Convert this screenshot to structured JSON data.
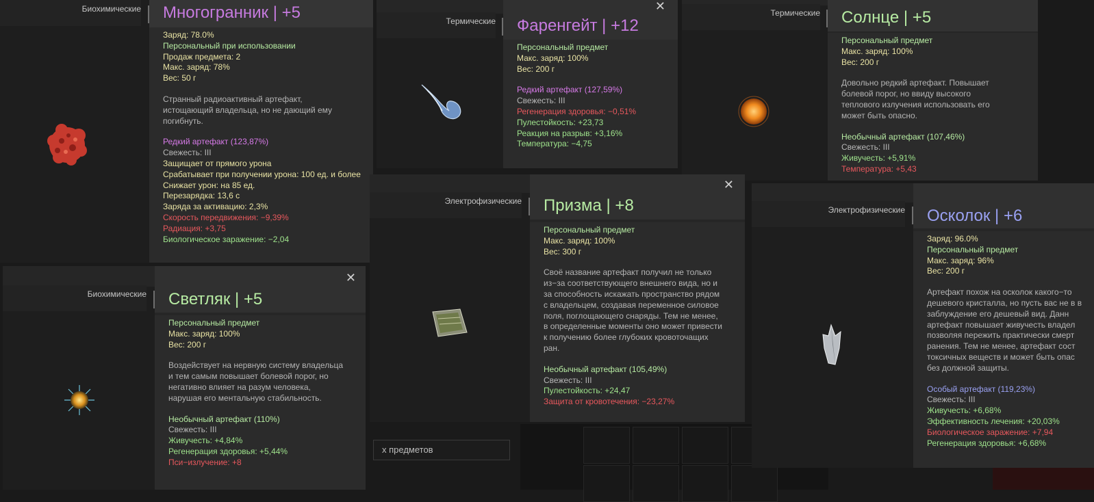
{
  "background": {
    "search_text": "х предметов"
  },
  "cards": {
    "mnogogrannik": {
      "category": "Биохимические",
      "title": "Многогранник | +5",
      "title_color": "#c77be0",
      "lines": [
        {
          "t": "Заряд: 78.0%",
          "c": "c-yellow"
        },
        {
          "t": "Персональный при использовании",
          "c": "c-lgreen"
        },
        {
          "t": "Продаж предмета: 2",
          "c": "c-yellow"
        },
        {
          "t": "Макс. заряд: 78%",
          "c": "c-yellow"
        },
        {
          "t": "Вес: 50 г",
          "c": "c-yellow"
        },
        {
          "gap": true
        },
        {
          "t": "Странный радиоактивный артефакт, истощающий владельца, но не дающий ему погибнуть.",
          "c": "desc",
          "w": 250
        },
        {
          "gap": true
        },
        {
          "t": "Редкий артефакт (123,87%)",
          "c": "c-pink"
        },
        {
          "t": "Свежесть: III",
          "c": "c-gray"
        },
        {
          "t": "Защищает от прямого урона",
          "c": "c-yellow"
        },
        {
          "t": "Срабатывает при получении урона: 100 ед. и более",
          "c": "c-yellow"
        },
        {
          "t": "Снижает урон: на 85 ед.",
          "c": "c-yellow"
        },
        {
          "t": "Перезарядка: 13,6 с",
          "c": "c-yellow"
        },
        {
          "t": "Заряда за активацию: 2,3%",
          "c": "c-yellow"
        },
        {
          "t": "Скорость передвижения: −9,39%",
          "c": "c-red"
        },
        {
          "t": "Радиация: +3,75",
          "c": "c-red"
        },
        {
          "t": "Биологическое заражение: −2,04",
          "c": "c-green"
        }
      ]
    },
    "farengeit": {
      "category": "Термические",
      "title": "Фаренгейт | +12",
      "title_color": "#c77be0",
      "lines": [
        {
          "t": "Персональный предмет",
          "c": "c-lgreen"
        },
        {
          "t": "Макс. заряд: 100%",
          "c": "c-yellow"
        },
        {
          "t": "Вес: 200 г",
          "c": "c-yellow"
        },
        {
          "gap": true
        },
        {
          "t": "Редкий артефакт (127,59%)",
          "c": "c-pink"
        },
        {
          "t": "Свежесть: III",
          "c": "c-gray"
        },
        {
          "t": "Регенерация здоровья: −0,51%",
          "c": "c-red"
        },
        {
          "t": "Пулестойкость: +23,73",
          "c": "c-green"
        },
        {
          "t": "Реакция на разрыв: +3,16%",
          "c": "c-green"
        },
        {
          "t": "Температура: −4,75",
          "c": "c-green"
        }
      ]
    },
    "solnce": {
      "category": "Термические",
      "title": "Солнце | +5",
      "title_color": "#b7eba3",
      "lines": [
        {
          "t": "Персональный предмет",
          "c": "c-lgreen"
        },
        {
          "t": "Макс. заряд: 100%",
          "c": "c-yellow"
        },
        {
          "t": "Вес: 200 г",
          "c": "c-yellow"
        },
        {
          "gap": true
        },
        {
          "t": "Довольно редкий артефакт. Повышает болевой порог, но ввиду высокого теплового излучения использовать его может быть опасно.",
          "c": "desc",
          "w": 240
        },
        {
          "gap": true
        },
        {
          "t": "Необычный артефакт (107,46%)",
          "c": "c-lgreen"
        },
        {
          "t": "Свежесть: III",
          "c": "c-gray"
        },
        {
          "t": "Живучесть: +5,91%",
          "c": "c-green"
        },
        {
          "t": "Температура: +5,43",
          "c": "c-red"
        }
      ]
    },
    "prizma": {
      "category": "Электрофизические",
      "title": "Призма | +8",
      "title_color": "#b7eba3",
      "lines": [
        {
          "t": "Персональный предмет",
          "c": "c-lgreen"
        },
        {
          "t": "Макс. заряд: 100%",
          "c": "c-yellow"
        },
        {
          "t": "Вес: 300 г",
          "c": "c-yellow"
        },
        {
          "gap": true
        },
        {
          "t": "Своё название артефакт получил не только из−за соответствующего внешнего вида, но и за способность искажать пространство рядом с владельцем, создавая переменное силовое поля, поглощающего снаряды. Тем не менее, в определенные моменты оно может привести к получению более глубоких кровоточащих ран.",
          "c": "desc",
          "w": 262
        },
        {
          "gap": true
        },
        {
          "t": "Необычный артефакт (105,49%)",
          "c": "c-lgreen"
        },
        {
          "t": "Свежесть: III",
          "c": "c-gray"
        },
        {
          "t": "Пулестойкость: +24,47",
          "c": "c-green"
        },
        {
          "t": "Защита от кровотечения: −23,27%",
          "c": "c-red"
        }
      ]
    },
    "oskolok": {
      "category": "Электрофизические",
      "title": "Осколок | +6",
      "title_color": "#9aa1f2",
      "lines": [
        {
          "t": "Заряд: 96.0%",
          "c": "c-yellow"
        },
        {
          "t": "Персональный предмет",
          "c": "c-lgreen"
        },
        {
          "t": "Макс. заряд: 96%",
          "c": "c-yellow"
        },
        {
          "t": "Вес: 200 г",
          "c": "c-yellow"
        },
        {
          "gap": true
        },
        {
          "t": "Артефакт похож на осколок какого−то дешевого кристалла, но пусть вас не в в заблуждение его дешевый вид. Данн артефакт повышает живучесть владел позволяя пережить практически смерт ранения. Тем не менее, артефакт сост токсичных веществ и может быть опас без должной защиты.",
          "c": "desc",
          "w": 236
        },
        {
          "gap": true
        },
        {
          "t": "Особый артефакт (119,23%)",
          "c": "c-blue"
        },
        {
          "t": "Свежесть: III",
          "c": "c-gray"
        },
        {
          "t": "Живучесть: +6,68%",
          "c": "c-green"
        },
        {
          "t": "Эффективность лечения: +20,03%",
          "c": "c-green"
        },
        {
          "t": "Биологическое заражение: +7,94",
          "c": "c-red"
        },
        {
          "t": "Регенерация здоровья: +6,68%",
          "c": "c-green"
        }
      ]
    },
    "svetlyak": {
      "category": "Биохимические",
      "title": "Светляк | +5",
      "title_color": "#b7eba3",
      "lines": [
        {
          "t": "Персональный предмет",
          "c": "c-lgreen"
        },
        {
          "t": "Макс. заряд: 100%",
          "c": "c-yellow"
        },
        {
          "t": "Вес: 200 г",
          "c": "c-yellow"
        },
        {
          "gap": true
        },
        {
          "t": "Воздействует на нервную систему владельца и тем самым повышает болевой порог, но негативно влияет на разум человека, нарушая его ментальную стабильность.",
          "c": "desc",
          "w": 258
        },
        {
          "gap": true
        },
        {
          "t": "Необычный артефакт (110%)",
          "c": "c-lgreen"
        },
        {
          "t": "Свежесть: III",
          "c": "c-gray"
        },
        {
          "t": "Живучесть: +4,84%",
          "c": "c-green"
        },
        {
          "t": "Регенерация здоровья: +5,44%",
          "c": "c-green"
        },
        {
          "t": "Пси−излучение: +8",
          "c": "c-red"
        }
      ]
    }
  },
  "close_symbol": "✕"
}
